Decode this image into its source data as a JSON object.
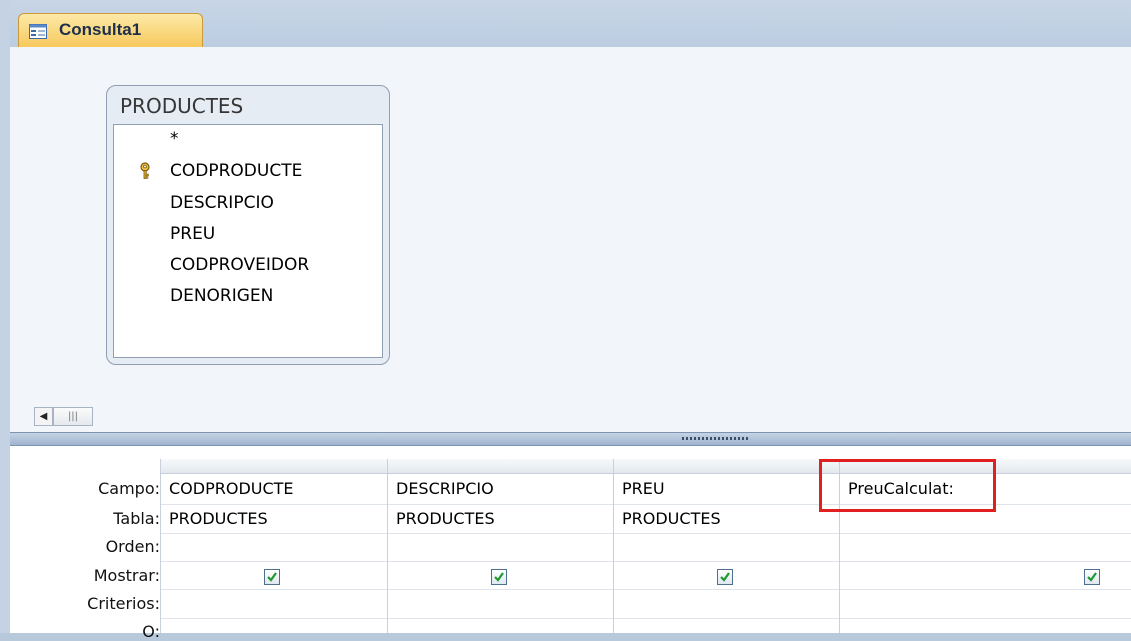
{
  "tab": {
    "title": "Consulta1"
  },
  "table_box": {
    "title": "PRODUCTES",
    "fields": [
      "*",
      "CODPRODUCTE",
      "DESCRIPCIO",
      "PREU",
      "CODPROVEIDOR",
      "DENORIGEN"
    ]
  },
  "grid": {
    "row_labels": [
      "Campo:",
      "Tabla:",
      "Orden:",
      "Mostrar:",
      "Criterios:",
      "O:"
    ],
    "columns": [
      {
        "campo": "CODPRODUCTE",
        "tabla": "PRODUCTES",
        "mostrar": true
      },
      {
        "campo": "DESCRIPCIO",
        "tabla": "PRODUCTES",
        "mostrar": true
      },
      {
        "campo": "PREU",
        "tabla": "PRODUCTES",
        "mostrar": true
      },
      {
        "campo": "PreuCalculat:",
        "tabla": "",
        "mostrar": true
      }
    ]
  },
  "colors": {
    "highlight": "#e02020",
    "tab_active": "#f7c95d"
  }
}
